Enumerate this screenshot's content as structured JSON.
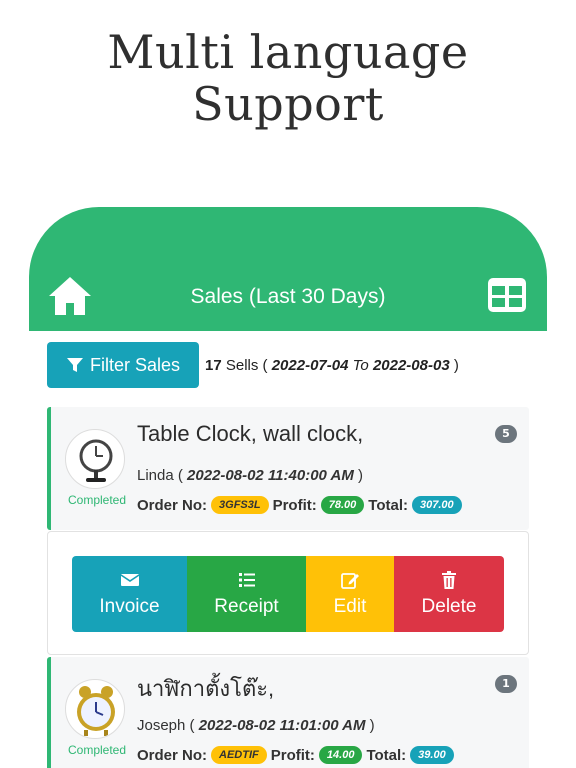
{
  "promo": {
    "line1": "Multi language",
    "line2": "Support"
  },
  "header": {
    "title": "Sales (Last 30 Days)",
    "home_icon": "home-icon",
    "grid_icon": "table-grid-icon",
    "color": "#2fb774"
  },
  "filter": {
    "button_label": "Filter Sales",
    "count": "17",
    "sells_word": "Sells",
    "open_paren": "(",
    "from_date": "2022-07-04",
    "to_word": "To",
    "to_date": "2022-08-03",
    "close_paren": ")"
  },
  "sales": [
    {
      "title": "Table Clock, wall clock,",
      "qty": "5",
      "status": "Completed",
      "customer": "Linda",
      "datetime": "2022-08-02 11:40:00 AM",
      "order_label": "Order No:",
      "order_no": "3GFS3L",
      "profit_label": "Profit:",
      "profit": "78.00",
      "total_label": "Total:",
      "total": "307.00"
    },
    {
      "title": "นาฬิกาตั้งโต๊ะ,",
      "qty": "1",
      "status": "Completed",
      "customer": "Joseph",
      "datetime": "2022-08-02 11:01:00 AM",
      "order_label": "Order No:",
      "order_no": "AEDTIF",
      "profit_label": "Profit:",
      "profit": "14.00",
      "total_label": "Total:",
      "total": "39.00"
    }
  ],
  "actions": {
    "invoice": "Invoice",
    "receipt": "Receipt",
    "edit": "Edit",
    "delete": "Delete"
  },
  "colors": {
    "accent": "#2fb774",
    "info": "#17a2b8",
    "success": "#28a745",
    "warning": "#ffc107",
    "danger": "#dc3545"
  }
}
